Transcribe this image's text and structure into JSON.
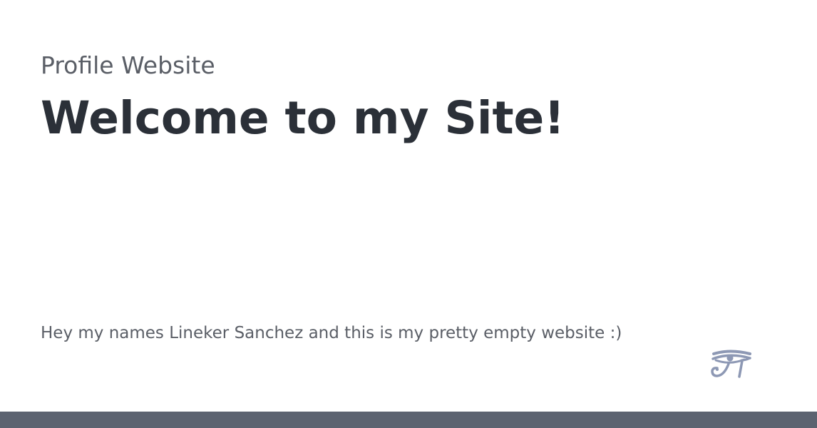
{
  "header": {
    "kicker": "Profile Website",
    "headline": "Welcome to my Site!"
  },
  "main": {
    "intro": "Hey my names Lineker Sanchez and this is my pretty empty website :)"
  },
  "logo": {
    "icon": "eye-of-horus-icon"
  },
  "colors": {
    "heading": "#2b3038",
    "muted_text": "#5a5e66",
    "logo": "#8d98b4",
    "footer": "#5c6370"
  }
}
